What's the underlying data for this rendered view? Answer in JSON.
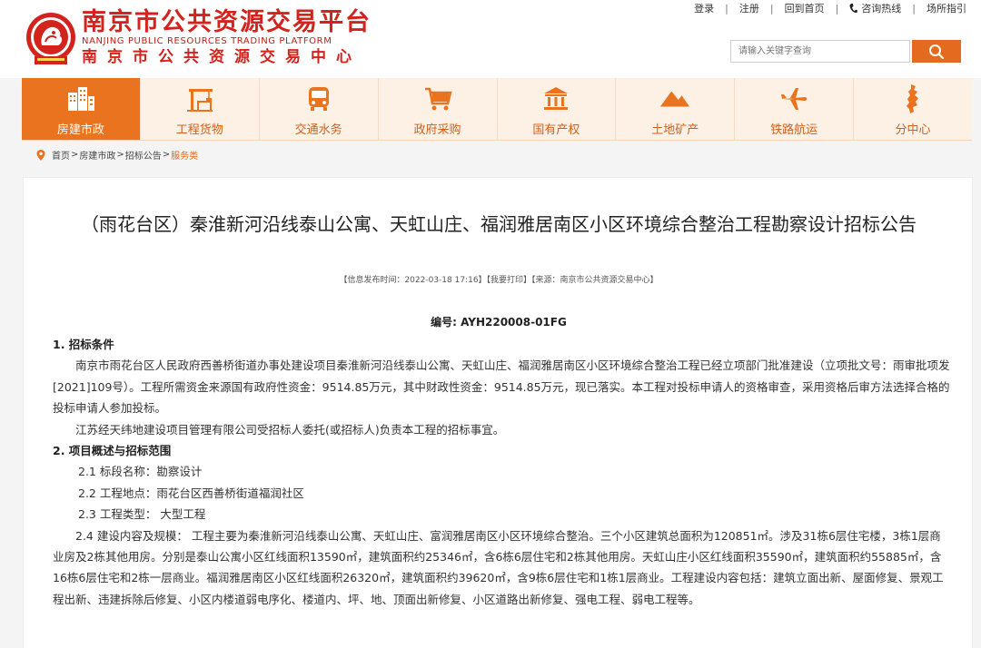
{
  "header": {
    "logo_cn": "南京市公共资源交易平台",
    "logo_en": "NANJING PUBLIC RESOURCES TRADING PLATFORM",
    "logo_center": "南京市公共资源交易中心",
    "toplinks": [
      "登录",
      "注册",
      "回到首页",
      "咨询热线",
      "场所指引"
    ],
    "search": {
      "placeholder": "请输入关键字查询"
    },
    "colors": {
      "brand_red": "#d2231d",
      "accent_orange": "#e9731f"
    }
  },
  "nav": {
    "items": [
      {
        "label": "房建市政",
        "icon": "building-icon",
        "active": true
      },
      {
        "label": "工程货物",
        "icon": "crane-icon",
        "active": false
      },
      {
        "label": "交通水务",
        "icon": "bus-icon",
        "active": false
      },
      {
        "label": "政府采购",
        "icon": "cart-icon",
        "active": false
      },
      {
        "label": "国有产权",
        "icon": "bank-icon",
        "active": false
      },
      {
        "label": "土地矿产",
        "icon": "mountain-icon",
        "active": false
      },
      {
        "label": "铁路航运",
        "icon": "plane-icon",
        "active": false
      },
      {
        "label": "分中心",
        "icon": "map-icon",
        "active": false
      }
    ]
  },
  "breadcrumb": {
    "items": [
      "首页",
      "房建市政",
      "招标公告",
      "服务类"
    ]
  },
  "article": {
    "title": "（雨花台区）秦淮新河沿线泰山公寓、天虹山庄、福润雅居南区小区环境综合整治工程勘察设计招标公告",
    "meta": "【信息发布时间：2022-03-18 17:16】【我要打印】【来源：南京市公共资源交易中心】",
    "code": "编号: AYH220008-01FG",
    "section1_heading": "1. 招标条件",
    "section1_p1": "南京市雨花台区人民政府西善桥街道办事处建设项目秦淮新河沿线泰山公寓、天虹山庄、福润雅居南区小区环境综合整治工程已经立项部门批准建设（立项批文号：雨审批项发[2021]109号）。工程所需资金来源国有政府性资金：9514.85万元，其中财政性资金：9514.85万元，现已落实。本工程对投标申请人的资格审查，采用资格后审方法选择合格的投标申请人参加投标。",
    "section1_p2": "江苏经天纬地建设项目管理有限公司受招标人委托(或招标人)负责本工程的招标事宜。",
    "section2_heading": "2. 项目概述与招标范围",
    "items": [
      "2.1 标段名称：勘察设计",
      "2.2 工程地点：雨花台区西善桥街道福润社区",
      "2.3 工程类型： 大型工程"
    ],
    "item_2_4": "2.4 建设内容及规模： 工程主要为秦淮新河沿线泰山公寓、天虹山庄、富润雅居南区小区环境综合整治。三个小区建筑总面积为120851㎡。涉及31栋6层住宅楼，3栋1层商业房及2栋其他用房。分别是泰山公寓小区红线面积13590㎡，建筑面积约25346㎡，含6栋6层住宅和2栋其他用房。天虹山庄小区红线面积35590㎡，建筑面积约55885㎡，含16栋6层住宅和2栋一层商业。福润雅居南区小区红线面积26320㎡，建筑面积约39620㎡，含9栋6层住宅和1栋1层商业。工程建设内容包括：建筑立面出新、屋面修复、景观工程出新、违建拆除后修复、小区内楼道弱电序化、楼道内、坪、地、顶面出新修复、小区道路出新修复、强电工程、弱电工程等。"
  }
}
